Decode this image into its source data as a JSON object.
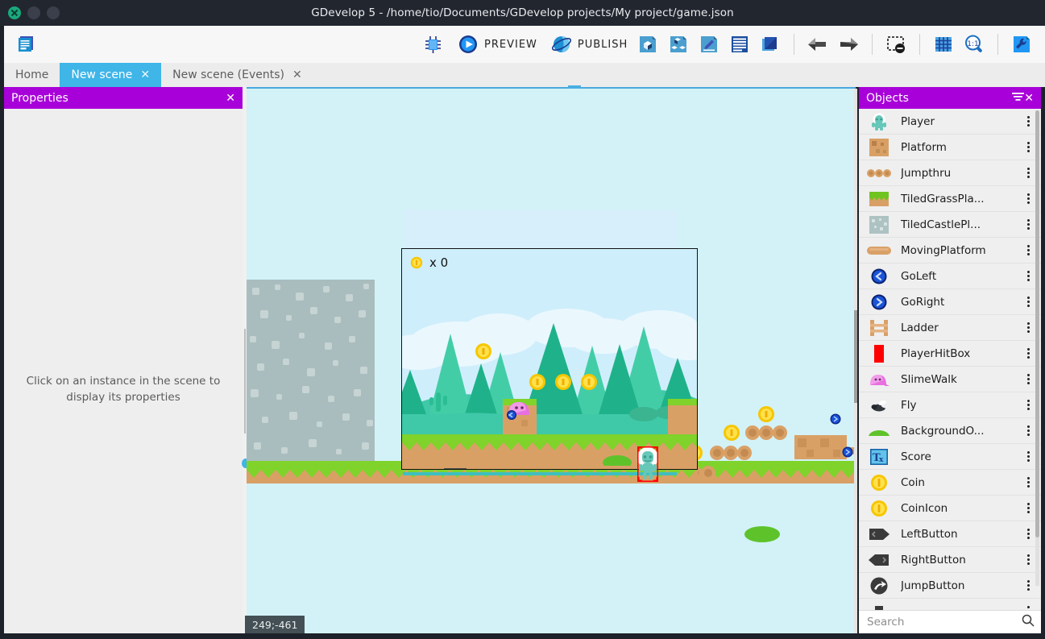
{
  "window": {
    "title": "GDevelop 5 - /home/tio/Documents/GDevelop projects/My project/game.json",
    "buttons": [
      {
        "name": "close",
        "icon": "close-icon"
      },
      {
        "name": "minimize",
        "icon": "minimize-icon"
      },
      {
        "name": "maximize",
        "icon": "maximize-icon"
      }
    ]
  },
  "toolbar": {
    "project_manager_icon": "project-manager-icon",
    "debug_label": "",
    "debug_icon": "debug-bug-icon",
    "preview_label": "PREVIEW",
    "preview_icon": "play-circle-icon",
    "publish_label": "PUBLISH",
    "publish_icon": "globe-icon",
    "right_icons": [
      "add-object-icon",
      "add-object-group-icon",
      "edit-scene-properties-icon",
      "open-scene-editor-icon",
      "open-layers-editor-icon",
      "undo-icon",
      "redo-icon",
      "hide-grid-icon",
      "show-grid-icon",
      "zoom-reset-1to1-icon",
      "open-settings-wrench-icon"
    ]
  },
  "tabs": [
    {
      "label": "Home",
      "active": false,
      "closable": false
    },
    {
      "label": "New scene",
      "active": true,
      "closable": true,
      "close_glyph": "✕"
    },
    {
      "label": "New scene (Events)",
      "active": false,
      "closable": true,
      "close_glyph": "✕"
    }
  ],
  "properties_panel": {
    "title": "Properties",
    "close_glyph": "✕",
    "empty_hint": "Click on an instance in the scene to display its properties"
  },
  "scene": {
    "hud": {
      "coin_icon": "coin-icon",
      "score_text": "x 0"
    },
    "cursor_coordinates": "249;-461",
    "selected_instance": "Player",
    "background_color": "#d2f2f7",
    "sky_color": "#cfeefb",
    "grass_color": "#7fd32b",
    "dirt_color": "#d9a066",
    "selection_color": "#ff0000",
    "camera_border_color": "#111111"
  },
  "objects_panel": {
    "title": "Objects",
    "filter_glyph": "☰",
    "close_glyph": "✕",
    "kebab_glyph": "⋮",
    "search": {
      "placeholder": "Search",
      "value": "",
      "icon": "search-icon"
    },
    "items": [
      {
        "label": "Player",
        "icon": "player-sprite-icon"
      },
      {
        "label": "Platform",
        "icon": "platform-box-icon"
      },
      {
        "label": "Jumpthru",
        "icon": "jumpthru-icon"
      },
      {
        "label": "TiledGrassPla...",
        "icon": "tiled-grass-platform-icon"
      },
      {
        "label": "TiledCastlePl...",
        "icon": "tiled-castle-platform-icon"
      },
      {
        "label": "MovingPlatform",
        "icon": "moving-platform-icon"
      },
      {
        "label": "GoLeft",
        "icon": "go-left-icon"
      },
      {
        "label": "GoRight",
        "icon": "go-right-icon"
      },
      {
        "label": "Ladder",
        "icon": "ladder-icon"
      },
      {
        "label": "PlayerHitBox",
        "icon": "player-hitbox-icon"
      },
      {
        "label": "SlimeWalk",
        "icon": "slime-walk-icon"
      },
      {
        "label": "Fly",
        "icon": "fly-icon"
      },
      {
        "label": "BackgroundO...",
        "icon": "background-object-icon"
      },
      {
        "label": "Score",
        "icon": "text-object-icon"
      },
      {
        "label": "Coin",
        "icon": "coin-icon"
      },
      {
        "label": "CoinIcon",
        "icon": "coin-icon"
      },
      {
        "label": "LeftButton",
        "icon": "left-button-icon"
      },
      {
        "label": "RightButton",
        "icon": "right-button-icon"
      },
      {
        "label": "JumpButton",
        "icon": "jump-button-icon"
      },
      {
        "label": "",
        "icon": "arrow-button-icon"
      }
    ]
  },
  "colors": {
    "panel_header": "#a800d8",
    "active_tab": "#3fb5e8",
    "titlebar": "#22262f",
    "toolbar_bg": "#f7f7f7"
  }
}
